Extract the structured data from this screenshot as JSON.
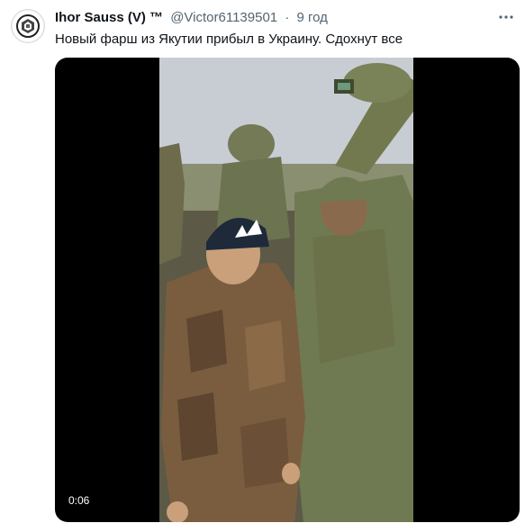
{
  "tweet": {
    "author_name": "Ihor Sauss (V) ™",
    "handle": "@Victor61139501",
    "separator": "·",
    "time": "9 год",
    "text": "Новый фарш из Якутии прибыл в Украину. Сдохнут все",
    "more_icon": "more-horizontal-icon"
  },
  "video": {
    "timestamp": "0:06"
  },
  "colors": {
    "text_primary": "#0f1419",
    "text_secondary": "#536471",
    "media_background": "#000000"
  }
}
